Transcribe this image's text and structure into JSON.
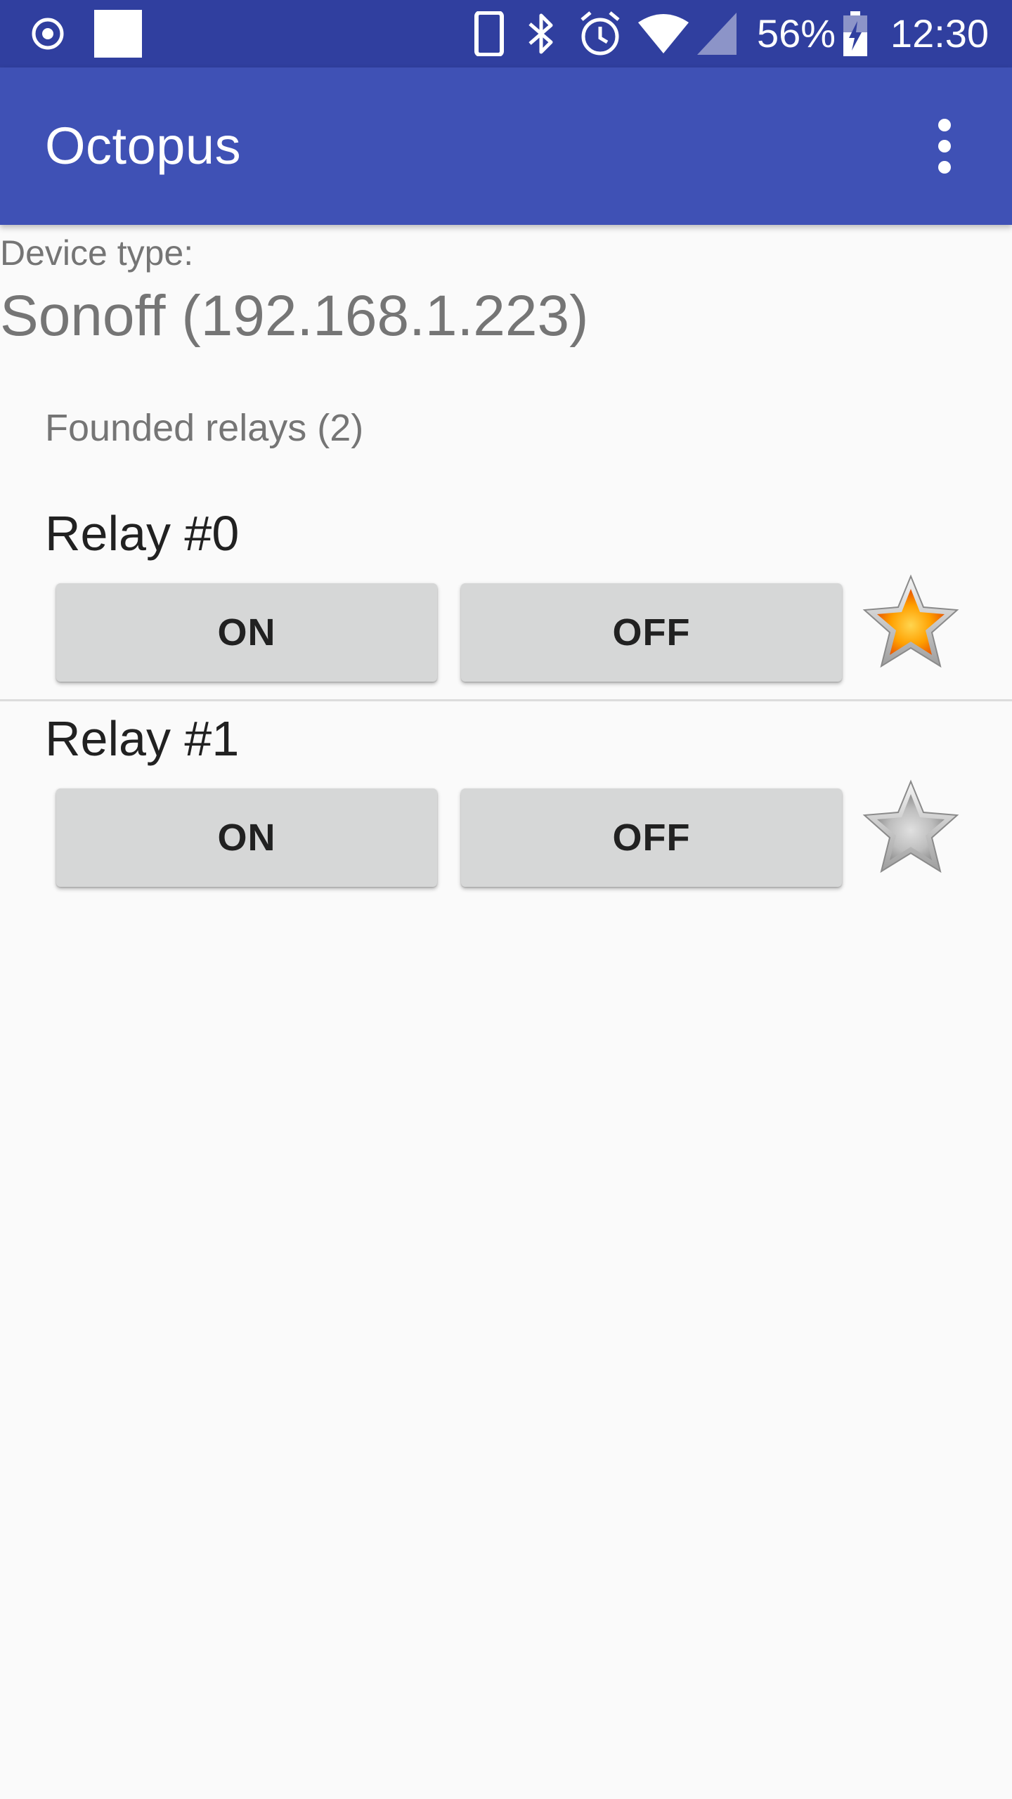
{
  "status_bar": {
    "battery_percent": "56%",
    "time": "12:30",
    "icons": [
      "record-icon",
      "notification-square-icon",
      "phone-icon",
      "bluetooth-icon",
      "alarm-icon",
      "wifi-icon",
      "signal-icon",
      "battery-charging-icon"
    ]
  },
  "app_bar": {
    "title": "Octopus",
    "menu_icon": "more-vert-icon"
  },
  "device": {
    "type_label": "Device type:",
    "name": "Sonoff (192.168.1.223)"
  },
  "relays_header": "Founded relays (2)",
  "relays": [
    {
      "title": "Relay #0",
      "on_label": "ON",
      "off_label": "OFF",
      "favorite": true
    },
    {
      "title": "Relay #1",
      "on_label": "ON",
      "off_label": "OFF",
      "favorite": false
    }
  ],
  "colors": {
    "status_bar": "#303f9f",
    "app_bar": "#3f51b5",
    "background": "#fafafa",
    "button": "#d6d7d7",
    "star_active": "#ff9800",
    "star_inactive": "#b0b0b0"
  }
}
